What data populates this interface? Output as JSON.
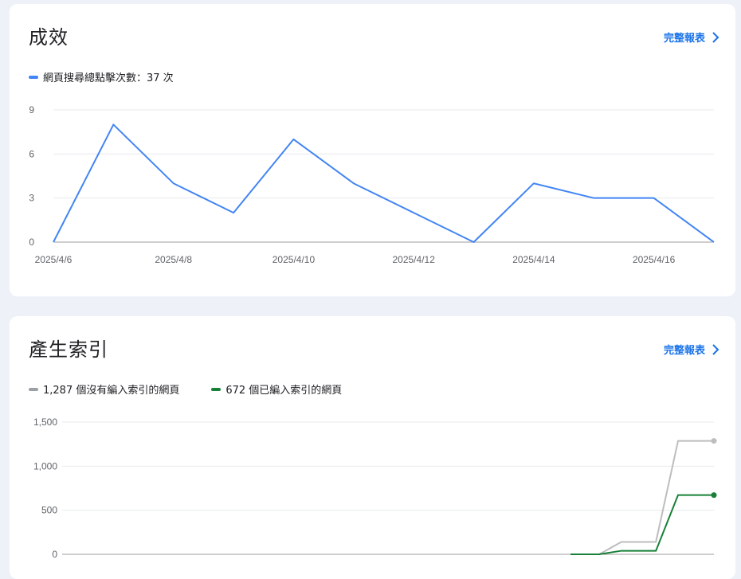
{
  "performance": {
    "title": "成效",
    "report_link": "完整報表",
    "legend": [
      {
        "label": "網頁搜尋總點擊次數：37 次",
        "color": "#4285f4"
      }
    ]
  },
  "indexing": {
    "title": "產生索引",
    "report_link": "完整報表",
    "legend": [
      {
        "label": "1,287 個沒有編入索引的網頁",
        "color": "#9aa0a6"
      },
      {
        "label": "672 個已編入索引的網頁",
        "color": "#188038"
      }
    ]
  },
  "chart_data": [
    {
      "type": "line",
      "title": "",
      "xlabel": "",
      "ylabel": "",
      "x": [
        "2025/4/6",
        "2025/4/7",
        "2025/4/8",
        "2025/4/9",
        "2025/4/10",
        "2025/4/11",
        "2025/4/12",
        "2025/4/13",
        "2025/4/14",
        "2025/4/15",
        "2025/4/16",
        "2025/4/17"
      ],
      "x_tick_labels": [
        "2025/4/6",
        "2025/4/8",
        "2025/4/10",
        "2025/4/12",
        "2025/4/14",
        "2025/4/16"
      ],
      "ylim": [
        0,
        9
      ],
      "y_ticks": [
        "0",
        "3",
        "6",
        "9"
      ],
      "series": [
        {
          "name": "網頁搜尋總點擊次數：37 次",
          "color": "#4285f4",
          "values": [
            0,
            8,
            4,
            2,
            7,
            4,
            2,
            0,
            4,
            3,
            3,
            0
          ]
        }
      ],
      "grid": true,
      "legend_position": "top-left"
    },
    {
      "type": "line",
      "title": "",
      "xlabel": "",
      "ylabel": "",
      "ylim": [
        0,
        1500
      ],
      "y_ticks": [
        "0",
        "500",
        "1,000",
        "1,500"
      ],
      "series": [
        {
          "name": "1,287 個沒有編入索引的網頁",
          "color": "#bdbdbd",
          "step": true,
          "points": [
            [
              0,
              0
            ],
            [
              0.044,
              0
            ],
            [
              0.078,
              140
            ],
            [
              0.131,
              140
            ],
            [
              0.165,
              1287
            ],
            [
              0.22,
              1287
            ]
          ]
        },
        {
          "name": "672 個已編入索引的網頁",
          "color": "#188038",
          "step": true,
          "points": [
            [
              0,
              0
            ],
            [
              0.044,
              0
            ],
            [
              0.078,
              40
            ],
            [
              0.131,
              40
            ],
            [
              0.165,
              672
            ],
            [
              0.22,
              672
            ]
          ]
        }
      ],
      "grid": true,
      "legend_position": "top-left"
    }
  ]
}
